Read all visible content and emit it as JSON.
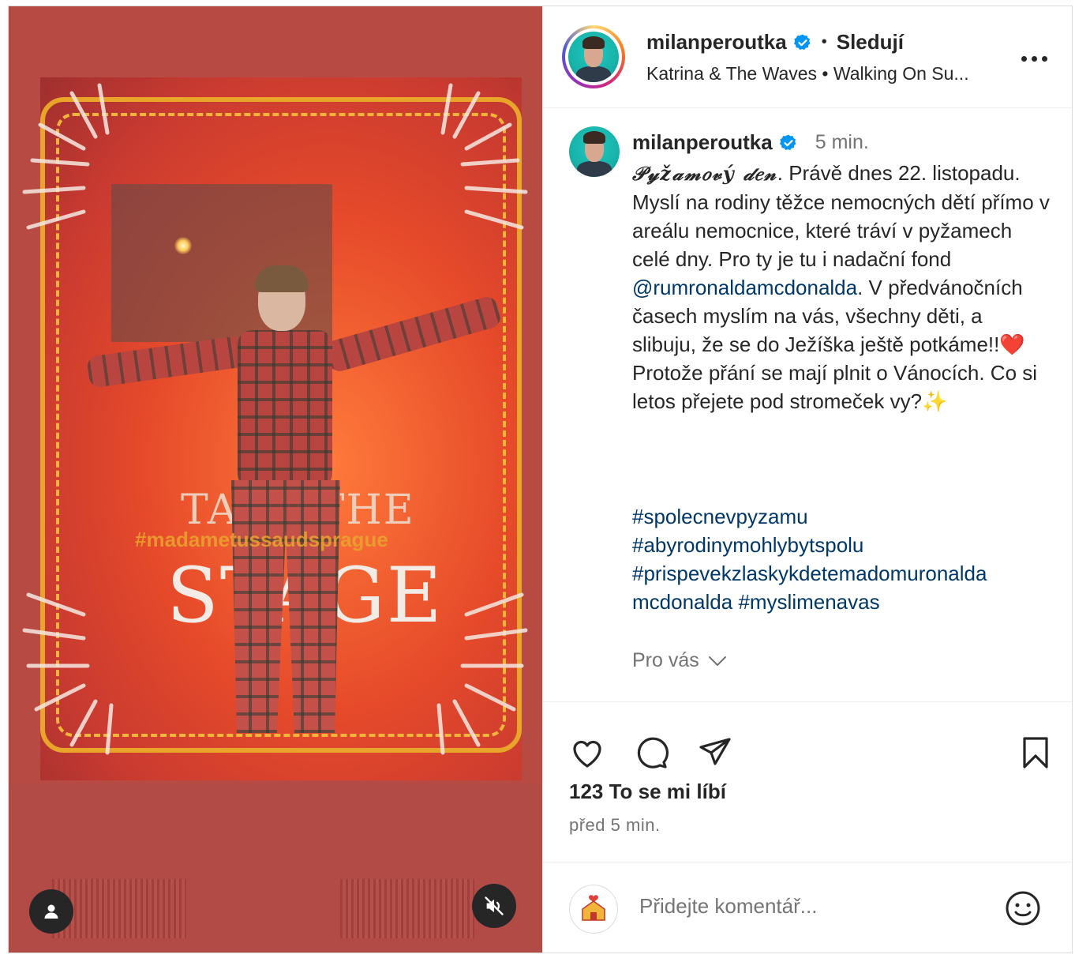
{
  "header": {
    "username": "milanperoutka",
    "separator": "•",
    "follow_status": "Sledují",
    "music": "Katrina & The Waves • Walking On Su..."
  },
  "caption": {
    "username": "milanperoutka",
    "time": "5 min.",
    "script_title": "𝒫𝓎ž𝒶𝓂𝑜𝓋ý 𝒹𝑒𝓃",
    "text_part1": ". Právě dnes 22. listopadu. Myslí na rodiny těžce nemocných dětí přímo v areálu nemocnice, které tráví v pyžamech celé dny. Pro ty je tu i nadační fond ",
    "mention": "@rumronaldamcdonalda",
    "text_part2": ". V předvánočních časech myslím na vás, všechny děti, a slibuju, že se do Ježíška ještě potkáme!!❤️ Protože přání se mají plnit o Vánocích. Co si letos přejete pod stromeček vy?✨",
    "hashtags": [
      "#spolecnevpyzamu",
      "#abyrodinymohlybytspolu",
      "#prispevekzlaskykdetemadomuronalda",
      "mcdonalda",
      "#myslimenavas"
    ],
    "for_you": "Pro vás"
  },
  "media": {
    "take": "TAKE THE",
    "stage": "STAGE",
    "hashtag": "#madametussaudsprague"
  },
  "actions": {
    "likes": "123 To se mi líbí",
    "ago": "před 5 min."
  },
  "comment": {
    "placeholder": "Přidejte komentář..."
  },
  "icons": {
    "verified": "verified-badge-icon",
    "more": "more-options-icon",
    "like": "heart-icon",
    "comment": "comment-icon",
    "share": "send-icon",
    "save": "bookmark-icon",
    "emoji": "emoji-icon",
    "user": "user-icon",
    "mute": "mute-icon"
  },
  "colors": {
    "link": "#00376b",
    "secondary_text": "#737373",
    "verified": "#0095f6"
  }
}
